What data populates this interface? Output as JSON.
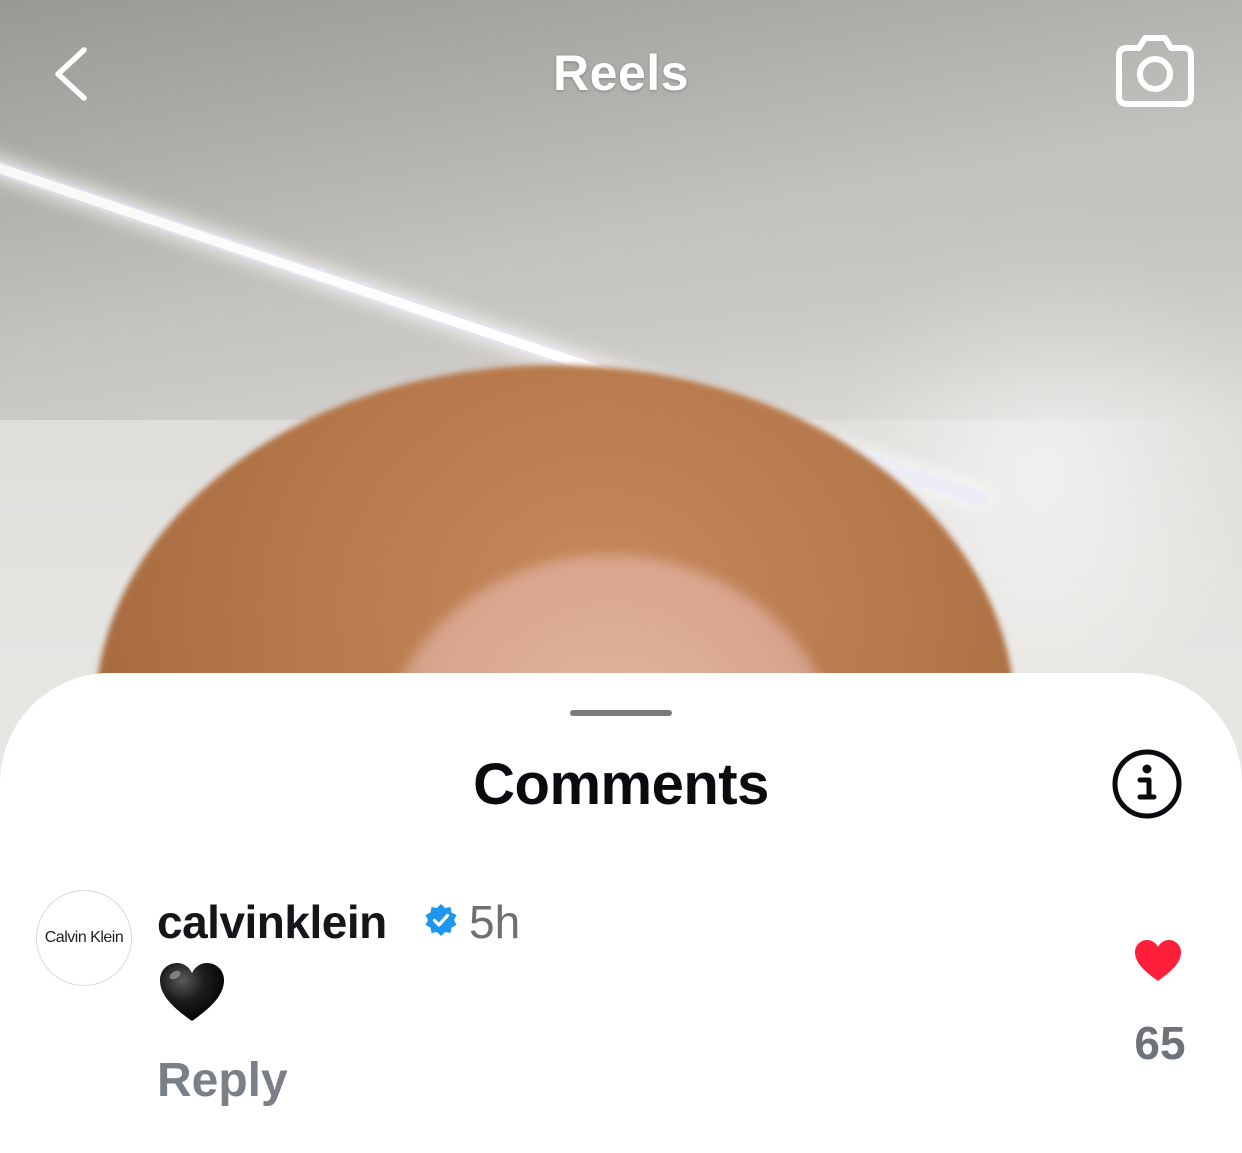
{
  "header": {
    "title": "Reels",
    "back_icon": "chevron-left-icon",
    "camera_icon": "camera-icon"
  },
  "comments_sheet": {
    "title": "Comments",
    "info_icon": "info-icon",
    "comments": [
      {
        "avatar_text": "Calvin Klein",
        "username": "calvinklein",
        "verified": true,
        "time": "5h",
        "text": "🖤",
        "reply_label": "Reply",
        "likes": "65",
        "liked": true
      }
    ]
  },
  "colors": {
    "verified_blue": "#1d96f0",
    "like_red": "#ff1f3a",
    "text_dark": "#0b0b0f",
    "text_muted": "#6e6e73"
  }
}
